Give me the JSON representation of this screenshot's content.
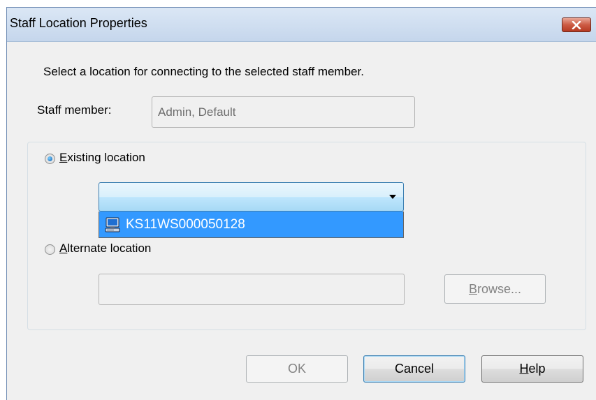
{
  "window": {
    "title": "Staff Location Properties"
  },
  "instruction": "Select a location for connecting to the selected staff member.",
  "staff_member": {
    "label": "Staff member:",
    "value": "Admin, Default"
  },
  "existing_location": {
    "label_accel": "E",
    "label_rest": "xisting location",
    "checked": true,
    "combo_value": "",
    "dropdown_items": [
      {
        "label": "KS11WS000050128",
        "icon": "computer-icon",
        "selected": true
      }
    ]
  },
  "alternate_location": {
    "label_accel": "A",
    "label_rest": "lternate location",
    "checked": false,
    "path_value": "",
    "browse_accel": "B",
    "browse_rest": "rowse..."
  },
  "buttons": {
    "ok_label": "OK",
    "cancel_label": "Cancel",
    "help_accel": "H",
    "help_rest": "elp"
  },
  "colors": {
    "selection": "#3399ff",
    "title_bar": "#c5d6ec",
    "close_button": "#cc5b44"
  }
}
